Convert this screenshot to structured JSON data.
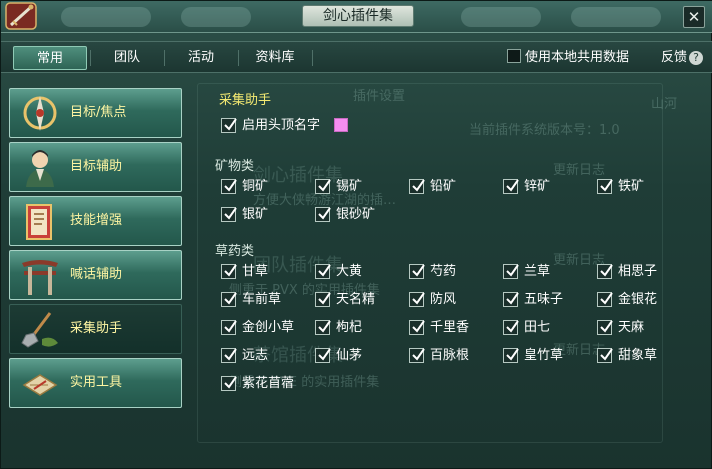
{
  "window": {
    "title": "剑心插件集",
    "close_glyph": "✕"
  },
  "tabs": [
    {
      "label": "常用",
      "active": true
    },
    {
      "label": "团队",
      "active": false
    },
    {
      "label": "活动",
      "active": false
    },
    {
      "label": "资料库",
      "active": false
    }
  ],
  "header_right": {
    "shared_data_label": "使用本地共用数据",
    "shared_data_checked": false,
    "feedback_label": "反馈",
    "feedback_icon": "?"
  },
  "sidebar": {
    "items": [
      {
        "label": "目标/焦点",
        "icon": "target-emblem-icon",
        "active": false
      },
      {
        "label": "目标辅助",
        "icon": "character-portrait-icon",
        "active": false
      },
      {
        "label": "技能增强",
        "icon": "skill-book-icon",
        "active": false
      },
      {
        "label": "喊话辅助",
        "icon": "gate-icon",
        "active": false
      },
      {
        "label": "采集助手",
        "icon": "shovel-icon",
        "active": true
      },
      {
        "label": "实用工具",
        "icon": "scroll-tool-icon",
        "active": false
      }
    ]
  },
  "background_ghost_text": {
    "panel_title": "插件设置",
    "version": "当前插件系统版本号：1.0",
    "items": [
      {
        "name": "剑心插件集",
        "desc": "方便大侠畅游江湖的插…",
        "log": "更新日志"
      },
      {
        "name": "团队插件集",
        "desc": "侧重于 PVX 的实用插件集",
        "log": "更新日志"
      },
      {
        "name": "茶馆插件集",
        "desc": "侧重于 PVE 的实用插件集",
        "log": "更新日志"
      }
    ],
    "corner": "山河"
  },
  "content": {
    "section_title": "采集助手",
    "show_name": {
      "label": "启用头顶名字",
      "checked": true,
      "color": "#f58df0"
    },
    "minerals": {
      "label": "矿物类",
      "items": [
        {
          "label": "铜矿",
          "checked": true
        },
        {
          "label": "锡矿",
          "checked": true
        },
        {
          "label": "铅矿",
          "checked": true
        },
        {
          "label": "锌矿",
          "checked": true
        },
        {
          "label": "铁矿",
          "checked": true
        },
        {
          "label": "银矿",
          "checked": true
        },
        {
          "label": "银砂矿",
          "checked": true
        }
      ]
    },
    "herbs": {
      "label": "草药类",
      "items": [
        {
          "label": "甘草",
          "checked": true
        },
        {
          "label": "大黄",
          "checked": true
        },
        {
          "label": "芍药",
          "checked": true
        },
        {
          "label": "兰草",
          "checked": true
        },
        {
          "label": "相思子",
          "checked": true
        },
        {
          "label": "车前草",
          "checked": true
        },
        {
          "label": "天名精",
          "checked": true
        },
        {
          "label": "防风",
          "checked": true
        },
        {
          "label": "五味子",
          "checked": true
        },
        {
          "label": "金银花",
          "checked": true
        },
        {
          "label": "金创小草",
          "checked": true
        },
        {
          "label": "枸杞",
          "checked": true
        },
        {
          "label": "千里香",
          "checked": true
        },
        {
          "label": "田七",
          "checked": true
        },
        {
          "label": "天麻",
          "checked": true
        },
        {
          "label": "远志",
          "checked": true
        },
        {
          "label": "仙茅",
          "checked": true
        },
        {
          "label": "百脉根",
          "checked": true
        },
        {
          "label": "皇竹草",
          "checked": true
        },
        {
          "label": "甜象草",
          "checked": true
        },
        {
          "label": "紫花苜蓿",
          "checked": true
        }
      ]
    }
  }
}
